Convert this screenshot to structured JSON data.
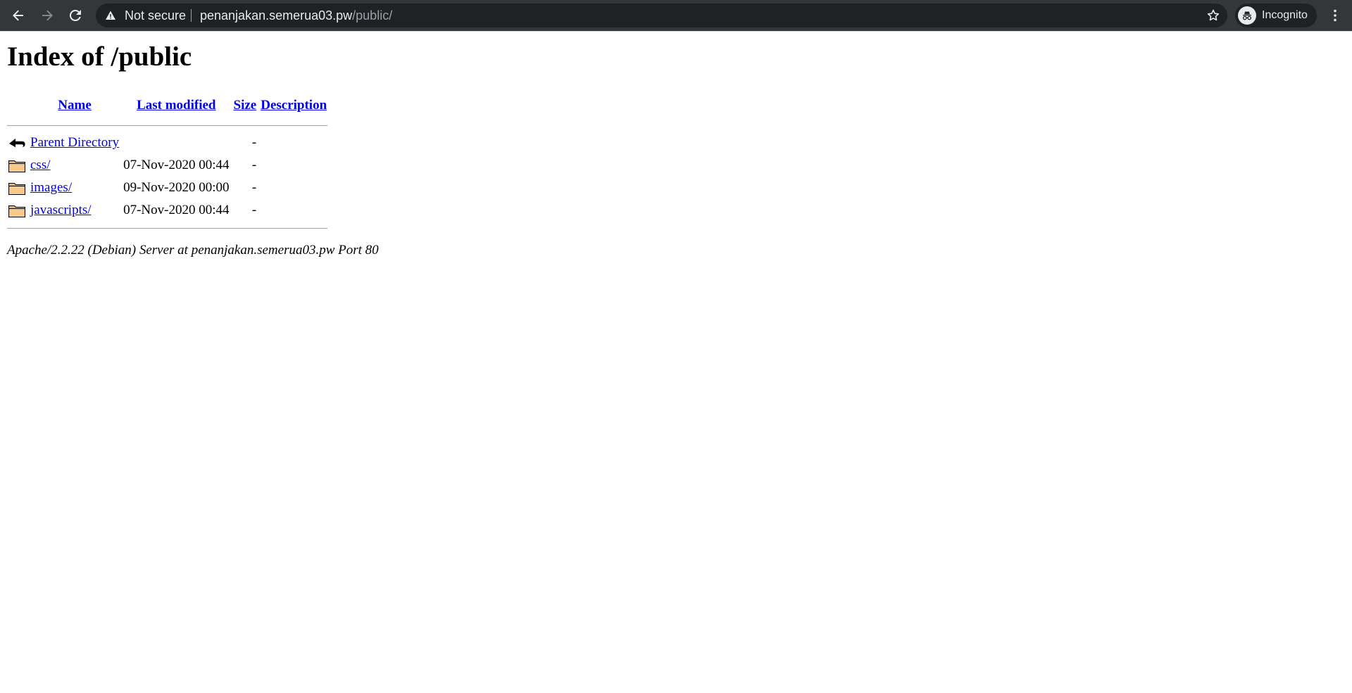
{
  "browser": {
    "security_label": "Not secure",
    "url_host": "penanjakan.semerua03.pw",
    "url_path": "/public/",
    "profile_label": "Incognito"
  },
  "page": {
    "title": "Index of /public",
    "columns": {
      "name": "Name",
      "last_modified": "Last modified",
      "size": "Size",
      "description": "Description"
    },
    "parent": {
      "name": "Parent Directory",
      "size": "-",
      "icon": "back-arrow-icon"
    },
    "rows": [
      {
        "name": "css/",
        "modified": "07-Nov-2020 00:44",
        "size": "-",
        "icon": "folder-icon"
      },
      {
        "name": "images/",
        "modified": "09-Nov-2020 00:00",
        "size": "-",
        "icon": "folder-icon"
      },
      {
        "name": "javascripts/",
        "modified": "07-Nov-2020 00:44",
        "size": "-",
        "icon": "folder-icon"
      }
    ],
    "footer": "Apache/2.2.22 (Debian) Server at penanjakan.semerua03.pw Port 80"
  },
  "colors": {
    "toolbar_bg": "#35363a",
    "omnibox_bg": "#202124",
    "link": "#0000ee",
    "folder": "#f0b25e"
  }
}
